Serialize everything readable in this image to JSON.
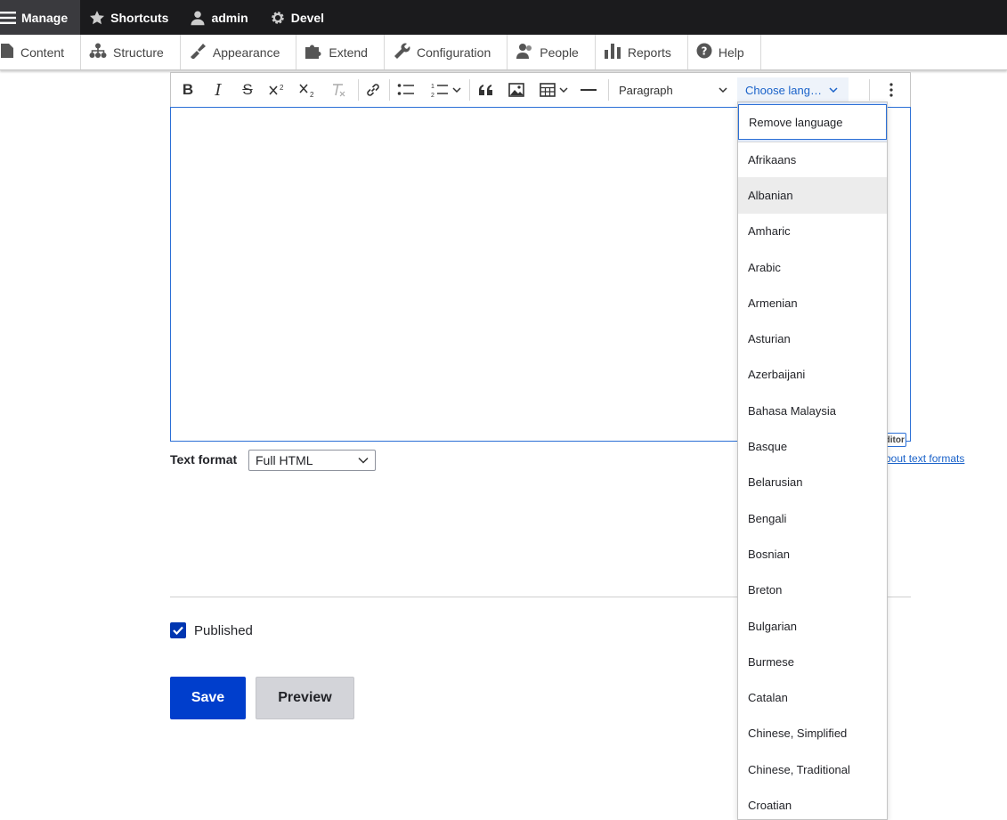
{
  "admin_bar": {
    "items": [
      {
        "label": "Manage",
        "icon": "hamburger-icon"
      },
      {
        "label": "Shortcuts",
        "icon": "star-icon"
      },
      {
        "label": "admin",
        "icon": "user-icon"
      },
      {
        "label": "Devel",
        "icon": "gear-icon"
      }
    ]
  },
  "tray": {
    "items": [
      {
        "label": "Content",
        "icon": "file-icon"
      },
      {
        "label": "Structure",
        "icon": "sitemap-icon"
      },
      {
        "label": "Appearance",
        "icon": "paintbrush-icon"
      },
      {
        "label": "Extend",
        "icon": "puzzle-icon"
      },
      {
        "label": "Configuration",
        "icon": "wrench-icon"
      },
      {
        "label": "People",
        "icon": "people-icon"
      },
      {
        "label": "Reports",
        "icon": "bar-chart-icon"
      },
      {
        "label": "Help",
        "icon": "help-icon"
      }
    ]
  },
  "toolbar": {
    "bold": "B",
    "italic": "I",
    "strike": "S",
    "heading_dropdown": "Paragraph",
    "language_button": "Choose lang…"
  },
  "editor": {
    "badge": "Editor"
  },
  "text_format": {
    "label": "Text format",
    "selected": "Full HTML",
    "about_link": "About text formats"
  },
  "published": {
    "label": "Published",
    "checked": true
  },
  "buttons": {
    "save": "Save",
    "preview": "Preview"
  },
  "language_dropdown": {
    "remove": "Remove language",
    "highlighted": "Albanian",
    "options": [
      "Afrikaans",
      "Albanian",
      "Amharic",
      "Arabic",
      "Armenian",
      "Asturian",
      "Azerbaijani",
      "Bahasa Malaysia",
      "Basque",
      "Belarusian",
      "Bengali",
      "Bosnian",
      "Breton",
      "Bulgarian",
      "Burmese",
      "Catalan",
      "Chinese, Simplified",
      "Chinese, Traditional",
      "Croatian"
    ]
  },
  "colors": {
    "accent": "#003ecc",
    "focus": "#2b6fd6",
    "link": "#1a62c9"
  }
}
